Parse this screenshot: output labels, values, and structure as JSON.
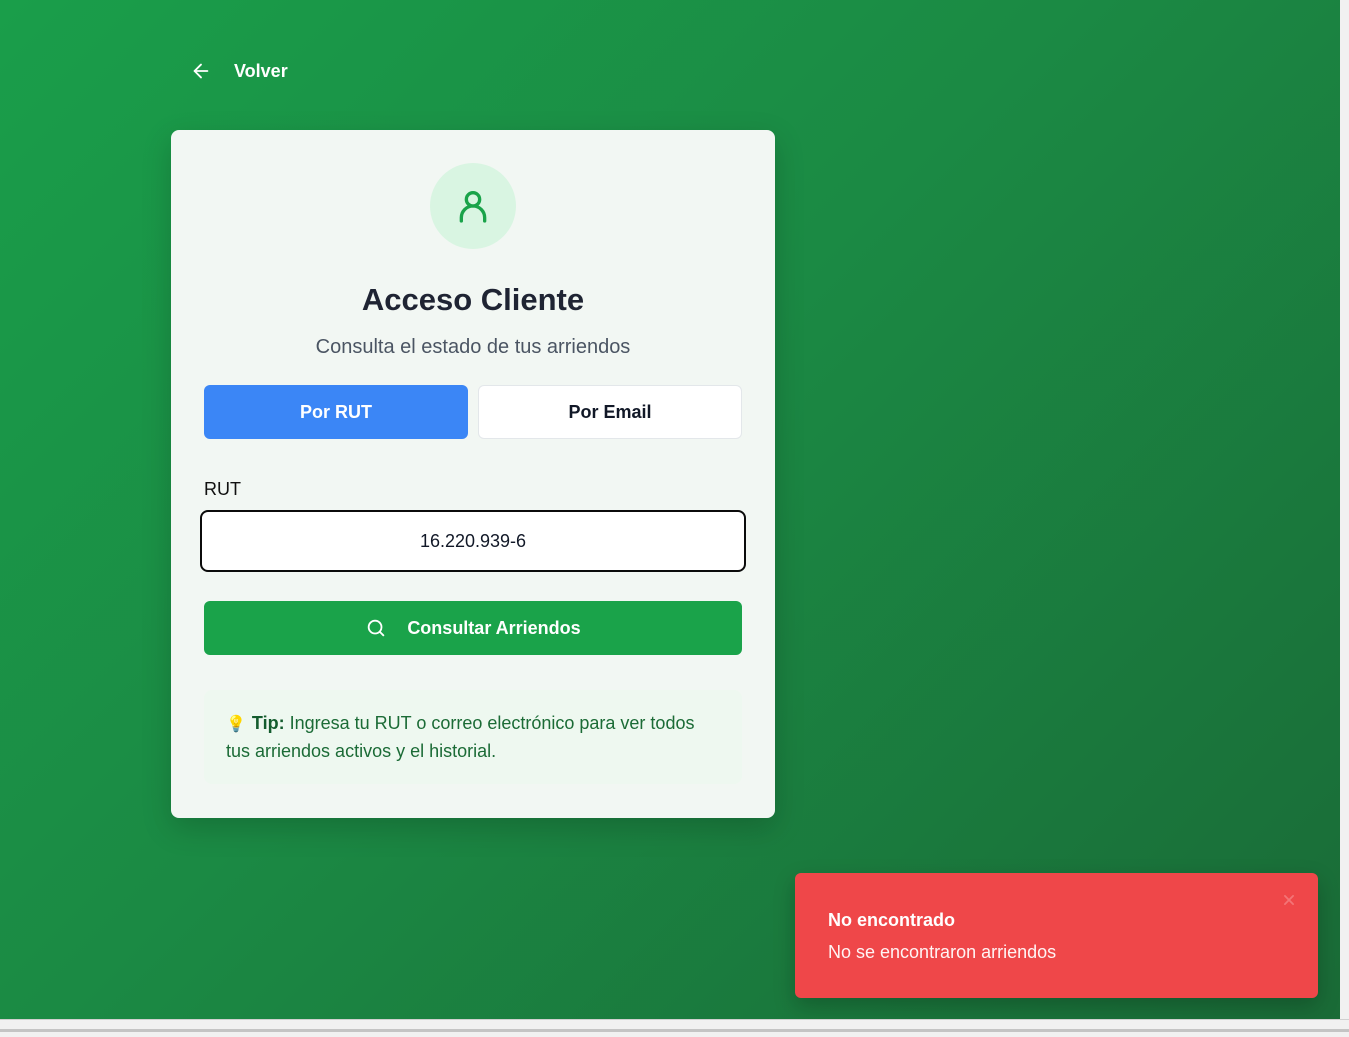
{
  "nav": {
    "back_label": "Volver"
  },
  "card": {
    "title": "Acceso Cliente",
    "subtitle": "Consulta el estado de tus arriendos",
    "tabs": [
      {
        "label": "Por RUT",
        "active": true
      },
      {
        "label": "Por Email",
        "active": false
      }
    ],
    "field_label": "RUT",
    "field_value": "16.220.939-6",
    "submit_label": "Consultar Arriendos",
    "tip": {
      "icon": "lightbulb-icon",
      "label": "Tip:",
      "text": " Ingresa tu RUT o correo electrónico para ver todos tus arriendos activos y el historial."
    }
  },
  "toast": {
    "title": "No encontrado",
    "message": "No se encontraron arriendos"
  },
  "colors": {
    "background": "#1b8a44",
    "primary_tab": "#3b86f6",
    "submit_button": "#1aa34a",
    "toast": "#ef4749"
  }
}
